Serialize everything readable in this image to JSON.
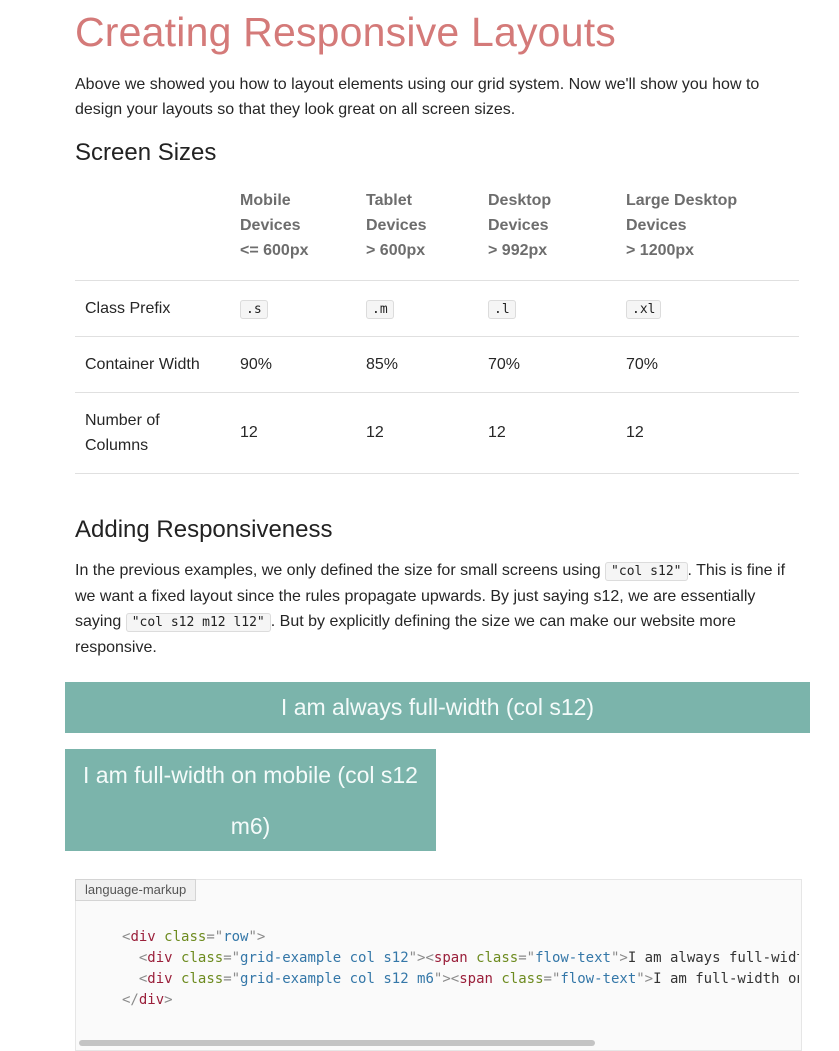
{
  "heading": "Creating Responsive Layouts",
  "intro": "Above we showed you how to layout elements using our grid system. Now we'll show you how to design your layouts so that they look great on all screen sizes.",
  "screen_sizes": {
    "title": "Screen Sizes",
    "columns": [
      {
        "line1": "Mobile",
        "line2": "Devices",
        "line3": "<= 600px"
      },
      {
        "line1": "Tablet",
        "line2": "Devices",
        "line3": "> 600px"
      },
      {
        "line1": "Desktop",
        "line2": "Devices",
        "line3": "> 992px"
      },
      {
        "line1": "Large Desktop",
        "line2": "Devices",
        "line3": "> 1200px"
      }
    ],
    "rows": [
      {
        "label": "Class Prefix",
        "values": [
          ".s",
          ".m",
          ".l",
          ".xl"
        ]
      },
      {
        "label": "Container Width",
        "values": [
          "90%",
          "85%",
          "70%",
          "70%"
        ]
      },
      {
        "label_line1": "Number of",
        "label_line2": "Columns",
        "values": [
          "12",
          "12",
          "12",
          "12"
        ]
      }
    ]
  },
  "responsiveness": {
    "title": "Adding Responsiveness",
    "p_part1": "In the previous examples, we only defined the size for small screens using ",
    "code1": "\"col s12\"",
    "p_part2": ". This is fine if we want a fixed layout since the rules propagate upwards. By just saying s12, we are essentially saying ",
    "code2": "\"col s12 m12 l12\"",
    "p_part3": ". But by explicitly defining the size we can make our website more responsive."
  },
  "examples": {
    "full": "I am always full-width (col s12)",
    "half_line1": "I am full-width on mobile (col s12",
    "half_line2": "m6)"
  },
  "code_block": {
    "language": "language-markup",
    "line1_tag": "div",
    "line1_attr": "class",
    "line1_val": "row",
    "line2_tag": "div",
    "line2_attr": "class",
    "line2_val": "grid-example col s12",
    "line2_span_tag": "span",
    "line2_span_attr": "class",
    "line2_span_val": "flow-text",
    "line2_text": "I am always full-width",
    "line3_tag": "div",
    "line3_attr": "class",
    "line3_val": "grid-example col s12 m6",
    "line3_span_tag": "span",
    "line3_span_attr": "class",
    "line3_span_val": "flow-text",
    "line3_text": "I am full-width on mobile",
    "line4_close": "div"
  },
  "colors": {
    "heading": "#d47a79",
    "grid_example": "#7bb4ab"
  }
}
